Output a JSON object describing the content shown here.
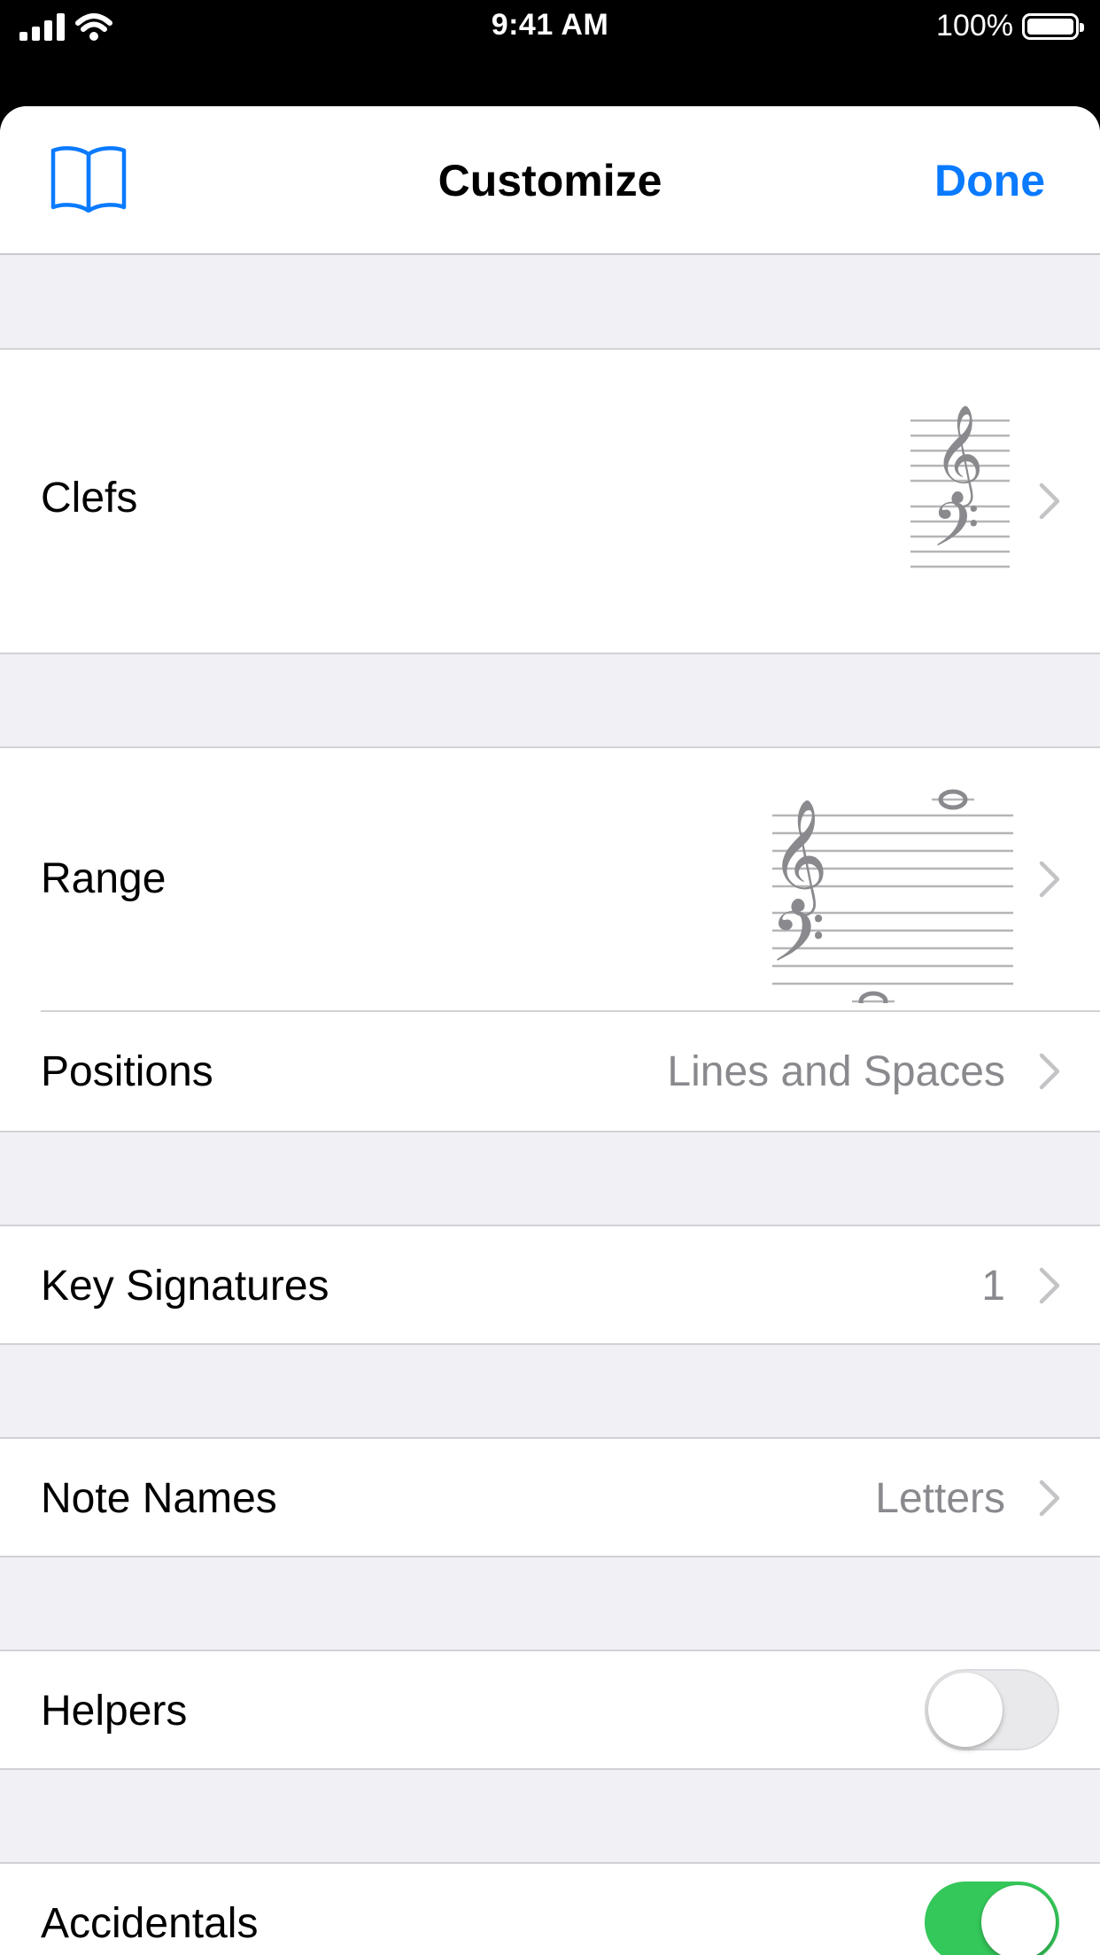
{
  "status_bar": {
    "time": "9:41 AM",
    "battery_percent": "100%",
    "signal_icon": "cellular-signal-icon",
    "wifi_icon": "wifi-icon",
    "battery_icon": "battery-icon"
  },
  "nav": {
    "title": "Customize",
    "done_label": "Done",
    "book_icon": "book-icon"
  },
  "settings": {
    "clefs": {
      "label": "Clefs",
      "preview_icon": "treble-bass-clef-icon"
    },
    "range": {
      "label": "Range",
      "preview_icon": "grand-staff-range-icon"
    },
    "positions": {
      "label": "Positions",
      "value": "Lines and Spaces"
    },
    "key_signatures": {
      "label": "Key Signatures",
      "value": "1"
    },
    "note_names": {
      "label": "Note Names",
      "value": "Letters"
    },
    "helpers": {
      "label": "Helpers",
      "enabled": false
    },
    "accidentals": {
      "label": "Accidentals",
      "enabled": true
    }
  },
  "colors": {
    "accent": "#0a7aff",
    "toggle_on": "#34c759",
    "grouped_background": "#f0f0f5",
    "secondary_text": "#8a8a8e"
  }
}
